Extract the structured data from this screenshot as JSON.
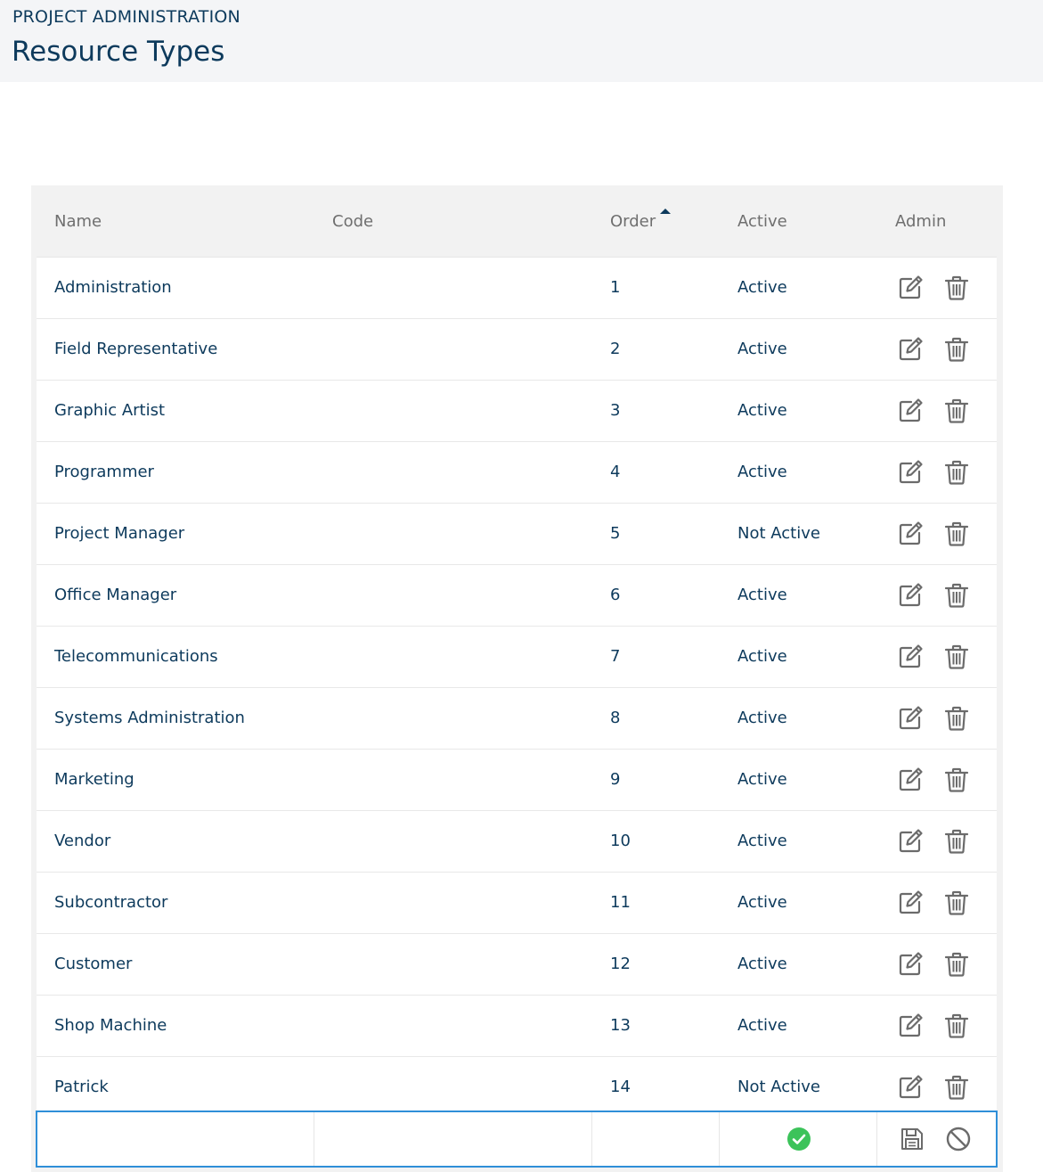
{
  "header": {
    "section": "PROJECT ADMINISTRATION",
    "title": "Resource Types"
  },
  "table": {
    "columns": {
      "name": "Name",
      "code": "Code",
      "order": "Order",
      "active": "Active",
      "admin": "Admin"
    },
    "sort": {
      "column": "Order",
      "direction": "ascending"
    },
    "rows": [
      {
        "name": "Administration",
        "code": "",
        "order": "1",
        "active": "Active"
      },
      {
        "name": "Field Representative",
        "code": "",
        "order": "2",
        "active": "Active"
      },
      {
        "name": "Graphic Artist",
        "code": "",
        "order": "3",
        "active": "Active"
      },
      {
        "name": "Programmer",
        "code": "",
        "order": "4",
        "active": "Active"
      },
      {
        "name": "Project Manager",
        "code": "",
        "order": "5",
        "active": "Not Active"
      },
      {
        "name": "Office Manager",
        "code": "",
        "order": "6",
        "active": "Active"
      },
      {
        "name": "Telecommunications",
        "code": "",
        "order": "7",
        "active": "Active"
      },
      {
        "name": "Systems Administration",
        "code": "",
        "order": "8",
        "active": "Active"
      },
      {
        "name": "Marketing",
        "code": "",
        "order": "9",
        "active": "Active"
      },
      {
        "name": "Vendor",
        "code": "",
        "order": "10",
        "active": "Active"
      },
      {
        "name": "Subcontractor",
        "code": "",
        "order": "11",
        "active": "Active"
      },
      {
        "name": "Customer",
        "code": "",
        "order": "12",
        "active": "Active"
      },
      {
        "name": "Shop Machine",
        "code": "",
        "order": "13",
        "active": "Active"
      },
      {
        "name": "Patrick",
        "code": "",
        "order": "14",
        "active": "Not Active"
      }
    ],
    "new_row": {
      "name": "",
      "code": "",
      "order": "",
      "active_checked": true
    }
  },
  "icons": {
    "edit": "edit-icon",
    "delete": "trash-icon",
    "check": "check-circle-icon",
    "save": "save-icon",
    "cancel": "cancel-icon"
  },
  "colors": {
    "text": "#0d3a5c",
    "header_text": "#6f6f6f",
    "icon": "#6b6b6b",
    "accent_border": "#2f8fd8",
    "check_green": "#3cc35a"
  }
}
